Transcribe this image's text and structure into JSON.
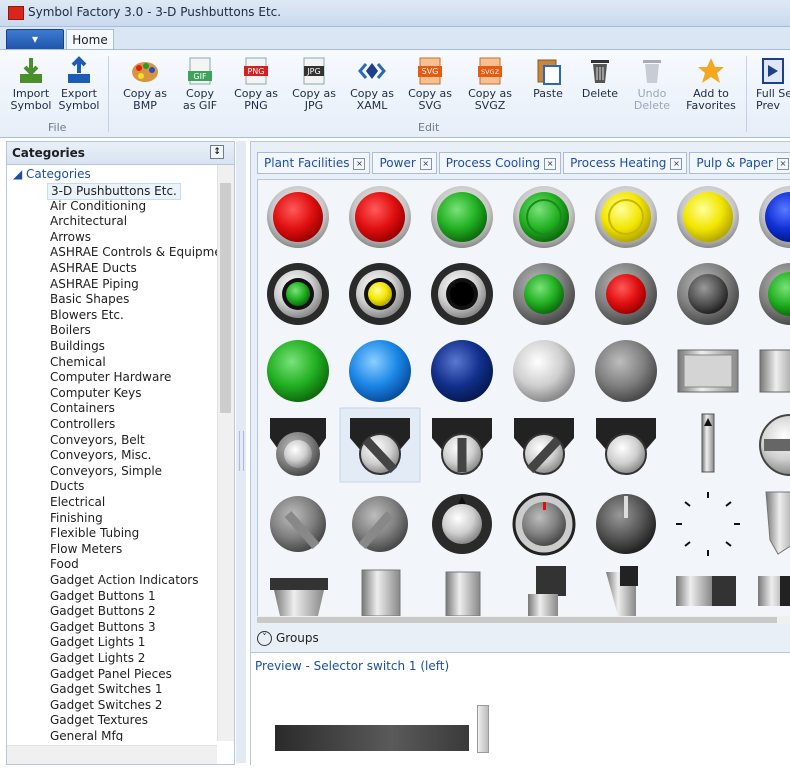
{
  "window": {
    "title": "Symbol Factory 3.0 - 3-D Pushbuttons Etc."
  },
  "ribbon": {
    "app_menu": "▾",
    "home_tab": "Home",
    "groups": {
      "file": "File",
      "edit": "Edit"
    },
    "buttons": {
      "import": "Import Symbol",
      "export": "Export Symbol",
      "copy_bmp": "Copy as BMP",
      "copy_gif": "Copy as GIF",
      "copy_png": "Copy as PNG",
      "copy_jpg": "Copy as JPG",
      "copy_xaml": "Copy as XAML",
      "copy_svg": "Copy as SVG",
      "copy_svgz": "Copy as SVGZ",
      "paste": "Paste",
      "delete": "Delete",
      "undo_delete": "Undo Delete",
      "add_favorites": "Add to Favorites",
      "full_screen": "Full Se Prev"
    },
    "badges": {
      "gif": "GIF",
      "png": "PNG",
      "jpg": "JPG",
      "svg": "SVG",
      "svgz": "SVGZ"
    }
  },
  "categories": {
    "header": "Categories",
    "pin": "↕",
    "root": "◢ Categories",
    "items": [
      "3-D Pushbuttons Etc.",
      "Air Conditioning",
      "Architectural",
      "Arrows",
      "ASHRAE Controls & Equipme",
      "ASHRAE Ducts",
      "ASHRAE Piping",
      "Basic Shapes",
      "Blowers Etc.",
      "Boilers",
      "Buildings",
      "Chemical",
      "Computer Hardware",
      "Computer Keys",
      "Containers",
      "Controllers",
      "Conveyors, Belt",
      "Conveyors, Misc.",
      "Conveyors, Simple",
      "Ducts",
      "Electrical",
      "Finishing",
      "Flexible Tubing",
      "Flow Meters",
      "Food",
      "Gadget Action Indicators",
      "Gadget Buttons 1",
      "Gadget Buttons 2",
      "Gadget Buttons 3",
      "Gadget Lights 1",
      "Gadget Lights 2",
      "Gadget Panel Pieces",
      "Gadget Switches 1",
      "Gadget Switches 2",
      "Gadget Textures",
      "General Mfg"
    ],
    "selected_index": 0
  },
  "doc_tabs": [
    "Plant Facilities",
    "Power",
    "Process Cooling",
    "Process Heating",
    "Pulp & Paper"
  ],
  "doc_tab_close": "×",
  "groups_label": "Groups",
  "groups_toggle": "˅",
  "preview": {
    "label": "Preview - Selector switch 1 (left)"
  },
  "colors": {
    "accent": "#1b4fa8",
    "red": "#e01010",
    "green": "#1fb01f",
    "yellow": "#f2e600",
    "blue": "#1030d8"
  }
}
